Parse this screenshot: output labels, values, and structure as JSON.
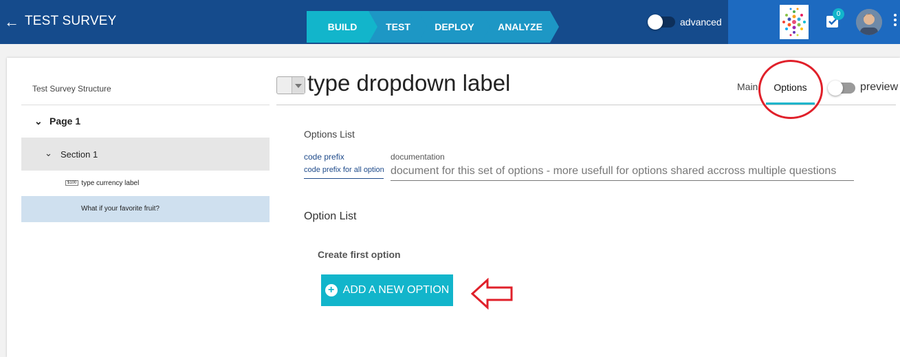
{
  "header": {
    "title": "TEST SURVEY",
    "back_icon": "arrow-left-icon",
    "steps": [
      {
        "label": "BUILD",
        "active": true,
        "color": "#12b5cb"
      },
      {
        "label": "TEST",
        "active": false,
        "color": "#1d97c5"
      },
      {
        "label": "DEPLOY",
        "active": false,
        "color": "#1d97c5"
      },
      {
        "label": "ANALYZE",
        "active": false,
        "color": "#1d97c5"
      }
    ],
    "advanced_label": "advanced",
    "advanced_on": false,
    "notification_count": "0"
  },
  "sidebar": {
    "title": "Test Survey Structure",
    "page": "Page 1",
    "section": "Section 1",
    "questions": [
      {
        "icon_text": "$100",
        "label": "type currency label",
        "selected": false
      },
      {
        "icon_text": "",
        "label": "What if your favorite fruit?",
        "selected": true
      }
    ]
  },
  "editor": {
    "question_title": "type dropdown label",
    "tabs": [
      {
        "label": "Main",
        "active": false
      },
      {
        "label": "Options",
        "active": true
      }
    ],
    "preview_label": "preview",
    "preview_on": false,
    "options_list_heading": "Options List",
    "code_prefix_label": "code prefix",
    "code_prefix_value": "code prefix for all options",
    "documentation_label": "documentation",
    "documentation_value": "document for this set of options - more usefull for options shared accross multiple questions",
    "option_list_heading": "Option List",
    "create_first": "Create first option",
    "add_button": "ADD A NEW OPTION"
  },
  "colors": {
    "header_bg": "#154b8c",
    "accent": "#12b5cb",
    "annotation": "#e0202a"
  }
}
